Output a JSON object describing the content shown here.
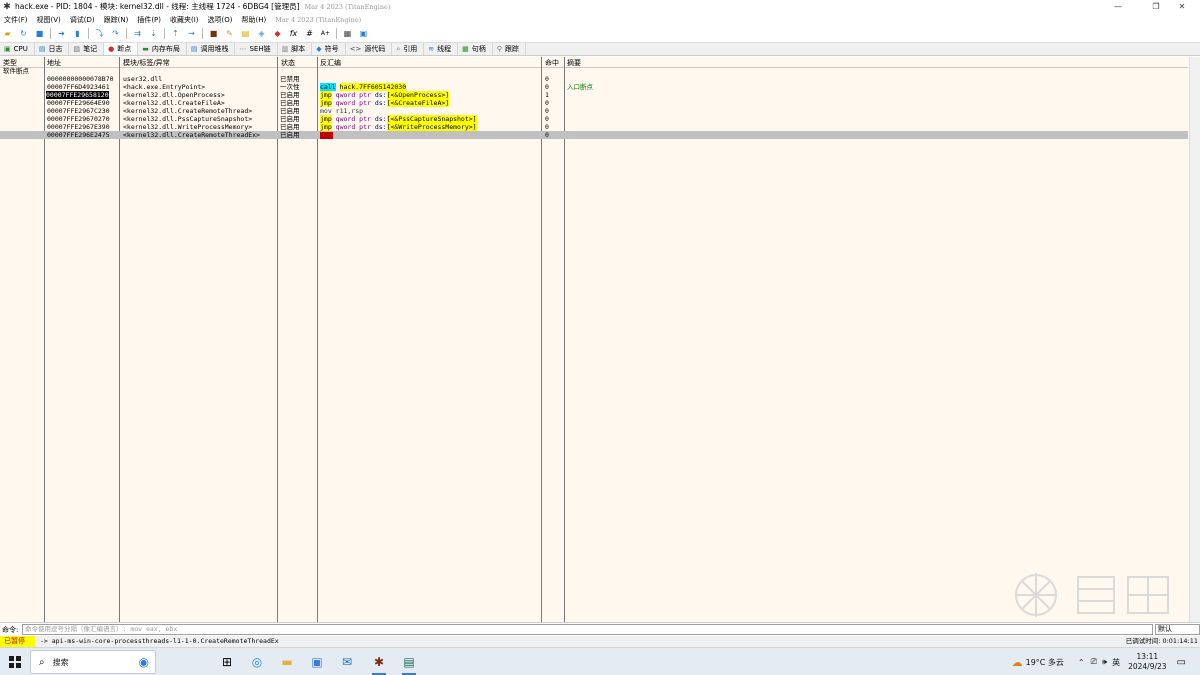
{
  "window": {
    "title": "hack.exe - PID: 1804 - 模块: kernel32.dll - 线程: 主线程 1724 - 6DBG4 [管理员]",
    "subtitle": "Mar 4 2023 (TitanEngine)",
    "controls": [
      "—",
      "❐",
      "✕"
    ]
  },
  "menu": [
    "文件(F)",
    "视图(V)",
    "调试(D)",
    "跟踪(N)",
    "插件(P)",
    "收藏夹(I)",
    "选项(O)",
    "帮助(H)"
  ],
  "tabs": [
    {
      "label": "CPU",
      "icon": "cpu-icon"
    },
    {
      "label": "日志",
      "icon": "log-icon"
    },
    {
      "label": "笔记",
      "icon": "notes-icon"
    },
    {
      "label": "断点",
      "icon": "breakpoint-icon"
    },
    {
      "label": "内存布局",
      "icon": "memory-icon"
    },
    {
      "label": "调用堆栈",
      "icon": "callstack-icon"
    },
    {
      "label": "SEH链",
      "icon": "seh-icon"
    },
    {
      "label": "脚本",
      "icon": "script-icon"
    },
    {
      "label": "符号",
      "icon": "symbol-icon"
    },
    {
      "label": "源代码",
      "icon": "source-icon"
    },
    {
      "label": "引用",
      "icon": "references-icon"
    },
    {
      "label": "线程",
      "icon": "threads-icon"
    },
    {
      "label": "句柄",
      "icon": "handles-icon"
    },
    {
      "label": "跟踪",
      "icon": "trace-icon"
    }
  ],
  "active_tab": "断点",
  "table": {
    "headers": [
      "类型",
      "地址",
      "模块/标签/异常",
      "状态",
      "反汇编",
      "命中",
      "摘要"
    ],
    "group_label": "软件断点",
    "rows": [
      {
        "addr": "00000000000078B70",
        "module": "user32.dll",
        "state": "已禁用",
        "disasm": "",
        "hits": "0",
        "summary": ""
      },
      {
        "addr": "00007FF6D4923461",
        "module": "<hack.exe.EntryPoint>",
        "state": "一次性",
        "disasm": {
          "mnemonic": "call",
          "target": "hack.7FF605142030"
        },
        "hits": "0",
        "summary": "入口断点"
      },
      {
        "addr": "00007FFE29658120",
        "module": "<kernel32.dll.OpenProcess>",
        "state": "已启用",
        "disasm": {
          "mnemonic": "jmp",
          "operand": "qword ptr",
          "seg": "ds:",
          "label": "[<&OpenProcess>]"
        },
        "hits": "1",
        "summary": ""
      },
      {
        "addr": "00007FFE29664E90",
        "module": "<kernel32.dll.CreateFileA>",
        "state": "已启用",
        "disasm": {
          "mnemonic": "jmp",
          "operand": "qword ptr",
          "seg": "ds:",
          "label": "[<&CreateFileA>]"
        },
        "hits": "0",
        "summary": ""
      },
      {
        "addr": "00007FFE2967C230",
        "module": "<kernel32.dll.CreateRemoteThread>",
        "state": "已启用",
        "disasm": {
          "plain": "mov r11,rsp"
        },
        "hits": "0",
        "summary": ""
      },
      {
        "addr": "00007FFE29670270",
        "module": "<kernel32.dll.PssCaptureSnapshot>",
        "state": "已启用",
        "disasm": {
          "mnemonic": "jmp",
          "operand": "qword ptr",
          "seg": "ds:",
          "label": "[<&PssCaptureSnapshot>]"
        },
        "hits": "0",
        "summary": ""
      },
      {
        "addr": "00007FFE2967E390",
        "module": "<kernel32.dll.WriteProcessMemory>",
        "state": "已启用",
        "disasm": {
          "mnemonic": "jmp",
          "operand": "qword ptr",
          "seg": "ds:",
          "label": "[<&WriteProcessMemory>]"
        },
        "hits": "0",
        "summary": ""
      },
      {
        "addr": "00007FFE296E2475",
        "module": "<kernel32.dll.CreateRemoteThreadEx>",
        "state": "已启用",
        "disasm": {
          "redbox": true
        },
        "hits": "0",
        "summary": ""
      }
    ]
  },
  "command": {
    "label": "命令:",
    "placeholder": "命令使用逗号分隔（像汇编语言）: mov eax, ebx",
    "default_label": "默认"
  },
  "status": {
    "paused": "已暂停",
    "message": "-> api-ms-win-core-processthreads-l1-1-0.CreateRemoteThreadEx",
    "elapsed": "已调试时间: 0:01:14:11"
  },
  "taskbar": {
    "search_label": "搜索",
    "weather": "19°C 多云",
    "ime": "英",
    "time": "13:11",
    "date": "2024/9/23"
  },
  "colors": {
    "main_bg": "#fef8ee",
    "selected_row": "#c0c0c0",
    "call_hl": "#00e5ff",
    "jmp_hl": "#ffff00",
    "paused_bg": "#ffff00",
    "paused_fg": "#c00000",
    "summary_green": "#008000",
    "break_red": "#c00000"
  }
}
